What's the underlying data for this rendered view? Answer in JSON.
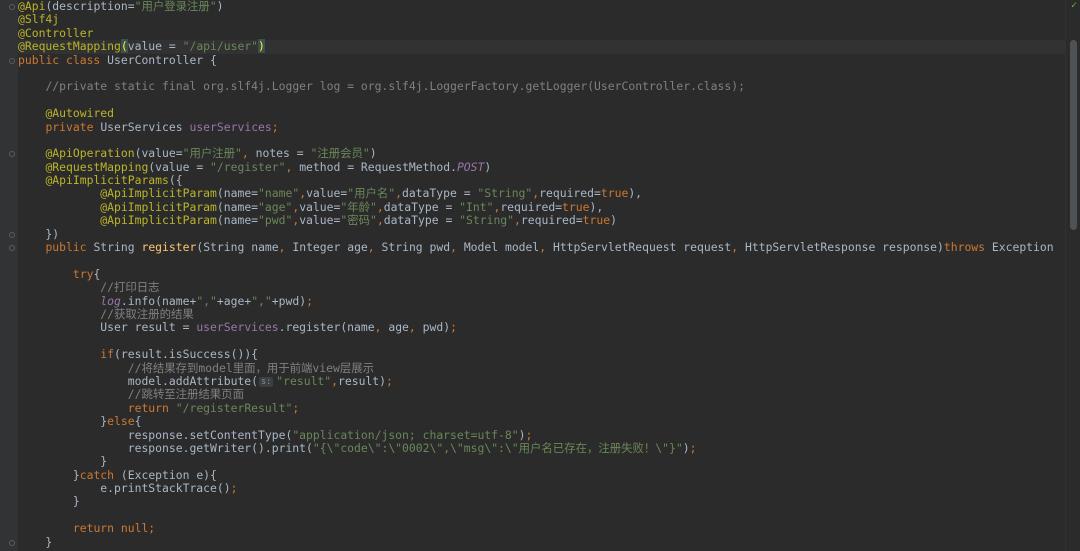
{
  "editor": {
    "lines": [
      [
        [
          "a",
          "@Api"
        ],
        [
          "t",
          "(description="
        ],
        [
          "s",
          "\"用户登录注册\""
        ],
        [
          "t",
          ")"
        ]
      ],
      [
        [
          "a",
          "@Slf4j"
        ]
      ],
      [
        [
          "a",
          "@Controller"
        ]
      ],
      [
        [
          "a",
          "@RequestMapping"
        ],
        [
          "hl",
          "("
        ],
        [
          "t",
          "value = "
        ],
        [
          "s",
          "\"/api/user\""
        ],
        [
          "hl",
          ")"
        ]
      ],
      [
        [
          "k",
          "public class "
        ],
        [
          "t",
          "UserController {"
        ]
      ],
      [],
      [
        [
          "t",
          "    "
        ],
        [
          "c",
          "//private static final org.slf4j.Logger log = org.slf4j.LoggerFactory.getLogger(UserController.class);"
        ]
      ],
      [],
      [
        [
          "t",
          "    "
        ],
        [
          "a",
          "@Autowired"
        ]
      ],
      [
        [
          "t",
          "    "
        ],
        [
          "k",
          "private "
        ],
        [
          "t",
          "UserServices "
        ],
        [
          "m",
          "userServices"
        ],
        [
          "k",
          ";"
        ]
      ],
      [],
      [
        [
          "t",
          "    "
        ],
        [
          "a",
          "@ApiOperation"
        ],
        [
          "t",
          "(value="
        ],
        [
          "s",
          "\"用户注册\""
        ],
        [
          "k",
          ", "
        ],
        [
          "t",
          "notes = "
        ],
        [
          "s",
          "\"注册会员\""
        ],
        [
          "t",
          ")"
        ]
      ],
      [
        [
          "t",
          "    "
        ],
        [
          "a",
          "@RequestMapping"
        ],
        [
          "t",
          "(value = "
        ],
        [
          "s",
          "\"/register\""
        ],
        [
          "k",
          ", "
        ],
        [
          "t",
          "method = RequestMethod."
        ],
        [
          "mi",
          "POST"
        ],
        [
          "t",
          ")"
        ]
      ],
      [
        [
          "t",
          "    "
        ],
        [
          "a",
          "@ApiImplicitParams"
        ],
        [
          "t",
          "({"
        ]
      ],
      [
        [
          "t",
          "            "
        ],
        [
          "a",
          "@ApiImplicitParam"
        ],
        [
          "t",
          "(name="
        ],
        [
          "s",
          "\"name\""
        ],
        [
          "k",
          ","
        ],
        [
          "t",
          "value="
        ],
        [
          "s",
          "\"用户名\""
        ],
        [
          "k",
          ","
        ],
        [
          "t",
          "dataType = "
        ],
        [
          "s",
          "\"String\""
        ],
        [
          "k",
          ","
        ],
        [
          "t",
          "required="
        ],
        [
          "k",
          "true"
        ],
        [
          "t",
          "),"
        ]
      ],
      [
        [
          "t",
          "            "
        ],
        [
          "a",
          "@ApiImplicitParam"
        ],
        [
          "t",
          "(name="
        ],
        [
          "s",
          "\"age\""
        ],
        [
          "k",
          ","
        ],
        [
          "t",
          "value="
        ],
        [
          "s",
          "\"年龄\""
        ],
        [
          "k",
          ","
        ],
        [
          "t",
          "dataType = "
        ],
        [
          "s",
          "\"Int\""
        ],
        [
          "k",
          ","
        ],
        [
          "t",
          "required="
        ],
        [
          "k",
          "true"
        ],
        [
          "t",
          "),"
        ]
      ],
      [
        [
          "t",
          "            "
        ],
        [
          "a",
          "@ApiImplicitParam"
        ],
        [
          "t",
          "(name="
        ],
        [
          "s",
          "\"pwd\""
        ],
        [
          "k",
          ","
        ],
        [
          "t",
          "value="
        ],
        [
          "s",
          "\"密码\""
        ],
        [
          "k",
          ","
        ],
        [
          "t",
          "dataType = "
        ],
        [
          "s",
          "\"String\""
        ],
        [
          "k",
          ","
        ],
        [
          "t",
          "required="
        ],
        [
          "k",
          "true"
        ],
        [
          "t",
          ")"
        ]
      ],
      [
        [
          "t",
          "    })"
        ]
      ],
      [
        [
          "t",
          "    "
        ],
        [
          "k",
          "public "
        ],
        [
          "t",
          "String "
        ],
        [
          "fn",
          "register"
        ],
        [
          "t",
          "(String name"
        ],
        [
          "k",
          ", "
        ],
        [
          "t",
          "Integer age"
        ],
        [
          "k",
          ", "
        ],
        [
          "t",
          "String pwd"
        ],
        [
          "k",
          ", "
        ],
        [
          "t",
          "Model model"
        ],
        [
          "k",
          ", "
        ],
        [
          "t",
          "HttpServletRequest request"
        ],
        [
          "k",
          ", "
        ],
        [
          "t",
          "HttpServletResponse response)"
        ],
        [
          "k",
          "throws "
        ],
        [
          "t",
          "Exception"
        ]
      ],
      [],
      [
        [
          "t",
          "        "
        ],
        [
          "k",
          "try"
        ],
        [
          "t",
          "{"
        ]
      ],
      [
        [
          "t",
          "            "
        ],
        [
          "c",
          "//打印日志"
        ]
      ],
      [
        [
          "t",
          "            "
        ],
        [
          "f",
          "log"
        ],
        [
          "t",
          ".info(name+"
        ],
        [
          "s",
          "\",\""
        ],
        [
          "t",
          "+age+"
        ],
        [
          "s",
          "\",\""
        ],
        [
          "t",
          "+pwd)"
        ],
        [
          "k",
          ";"
        ]
      ],
      [
        [
          "t",
          "            "
        ],
        [
          "c",
          "//获取注册的结果"
        ]
      ],
      [
        [
          "t",
          "            User result = "
        ],
        [
          "m",
          "userServices"
        ],
        [
          "t",
          ".register(name"
        ],
        [
          "k",
          ", "
        ],
        [
          "t",
          "age"
        ],
        [
          "k",
          ", "
        ],
        [
          "t",
          "pwd)"
        ],
        [
          "k",
          ";"
        ]
      ],
      [],
      [
        [
          "t",
          "            "
        ],
        [
          "k",
          "if"
        ],
        [
          "t",
          "(result.isSuccess()){"
        ]
      ],
      [
        [
          "t",
          "                "
        ],
        [
          "c",
          "//将结果存到model里面，用于前端view层展示"
        ]
      ],
      [
        [
          "t",
          "                model.addAttribute("
        ],
        [
          "hint",
          "s:"
        ],
        [
          "s",
          "\"result\""
        ],
        [
          "k",
          ","
        ],
        [
          "t",
          "result)"
        ],
        [
          "k",
          ";"
        ]
      ],
      [
        [
          "t",
          "                "
        ],
        [
          "c",
          "//跳转至注册结果页面"
        ]
      ],
      [
        [
          "t",
          "                "
        ],
        [
          "k",
          "return "
        ],
        [
          "s",
          "\"/registerResult\""
        ],
        [
          "k",
          ";"
        ]
      ],
      [
        [
          "t",
          "            }"
        ],
        [
          "k",
          "else"
        ],
        [
          "t",
          "{"
        ]
      ],
      [
        [
          "t",
          "                response.setContentType("
        ],
        [
          "s",
          "\"application/json; charset=utf-8\""
        ],
        [
          "t",
          ")"
        ],
        [
          "k",
          ";"
        ]
      ],
      [
        [
          "t",
          "                response.getWriter().print("
        ],
        [
          "s",
          "\"{\\\"code\\\":\\\"0002\\\",\\\"msg\\\":\\\"用户名已存在，注册失败！\\\"}\""
        ],
        [
          "t",
          ")"
        ],
        [
          "k",
          ";"
        ]
      ],
      [
        [
          "t",
          "            }"
        ]
      ],
      [
        [
          "t",
          "        }"
        ],
        [
          "k",
          "catch "
        ],
        [
          "t",
          "(Exception e){"
        ]
      ],
      [
        [
          "t",
          "            e.printStackTrace()"
        ],
        [
          "k",
          ";"
        ]
      ],
      [
        [
          "t",
          "        }"
        ]
      ],
      [],
      [
        [
          "t",
          "        "
        ],
        [
          "k",
          "return null;"
        ]
      ],
      [
        [
          "t",
          "    }"
        ]
      ]
    ],
    "current_line": 3,
    "fold_marker_lines": [
      0,
      4,
      11,
      17,
      18,
      40
    ]
  },
  "status": {
    "check_icon": "checkmark-icon",
    "color_ok": "#62b543"
  }
}
